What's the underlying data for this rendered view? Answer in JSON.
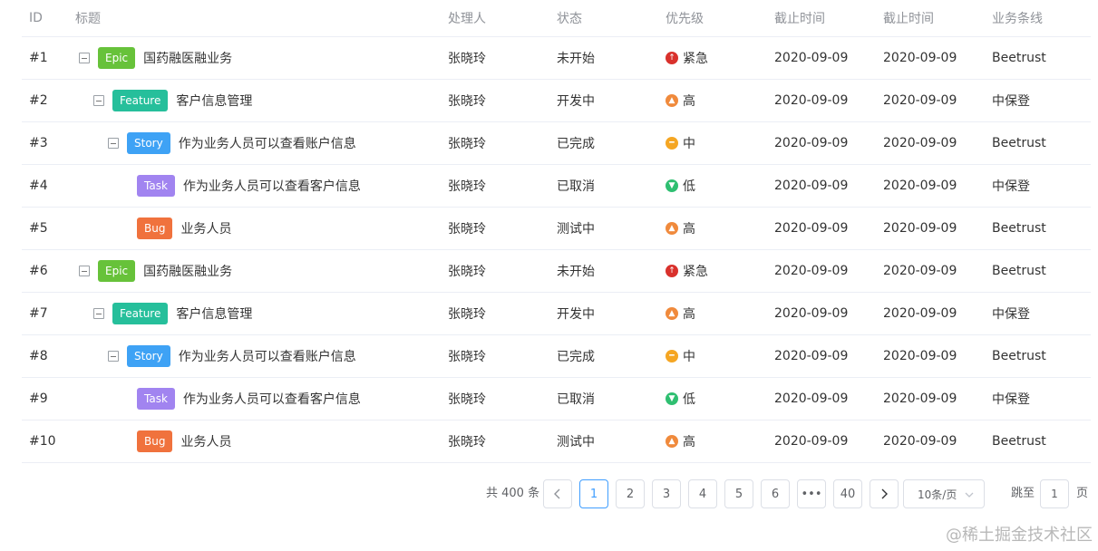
{
  "columns": {
    "id": "ID",
    "title": "标题",
    "owner": "处理人",
    "status": "状态",
    "priority": "优先级",
    "deadline1": "截止时间",
    "deadline2": "截止时间",
    "business_line": "业务条线"
  },
  "rows": [
    {
      "id": "#1",
      "level": 0,
      "collapsible": true,
      "tag": "Epic",
      "title": "国药融医融业务",
      "owner": "张晓玲",
      "status": "未开始",
      "priority": "紧急",
      "deadline1": "2020-09-09",
      "deadline2": "2020-09-09",
      "business_line": "Beetrust"
    },
    {
      "id": "#2",
      "level": 1,
      "collapsible": true,
      "tag": "Feature",
      "title": "客户信息管理",
      "owner": "张晓玲",
      "status": "开发中",
      "priority": "高",
      "deadline1": "2020-09-09",
      "deadline2": "2020-09-09",
      "business_line": "中保登"
    },
    {
      "id": "#3",
      "level": 2,
      "collapsible": true,
      "tag": "Story",
      "title": "作为业务人员可以查看账户信息",
      "owner": "张晓玲",
      "status": "已完成",
      "priority": "中",
      "deadline1": "2020-09-09",
      "deadline2": "2020-09-09",
      "business_line": "Beetrust"
    },
    {
      "id": "#4",
      "level": 3,
      "collapsible": false,
      "tag": "Task",
      "title": "作为业务人员可以查看客户信息",
      "owner": "张晓玲",
      "status": "已取消",
      "priority": "低",
      "deadline1": "2020-09-09",
      "deadline2": "2020-09-09",
      "business_line": "中保登"
    },
    {
      "id": "#5",
      "level": 3,
      "collapsible": false,
      "tag": "Bug",
      "title": "业务人员",
      "owner": "张晓玲",
      "status": "测试中",
      "priority": "高",
      "deadline1": "2020-09-09",
      "deadline2": "2020-09-09",
      "business_line": "Beetrust"
    },
    {
      "id": "#6",
      "level": 0,
      "collapsible": true,
      "tag": "Epic",
      "title": "国药融医融业务",
      "owner": "张晓玲",
      "status": "未开始",
      "priority": "紧急",
      "deadline1": "2020-09-09",
      "deadline2": "2020-09-09",
      "business_line": "Beetrust"
    },
    {
      "id": "#7",
      "level": 1,
      "collapsible": true,
      "tag": "Feature",
      "title": "客户信息管理",
      "owner": "张晓玲",
      "status": "开发中",
      "priority": "高",
      "deadline1": "2020-09-09",
      "deadline2": "2020-09-09",
      "business_line": "中保登"
    },
    {
      "id": "#8",
      "level": 2,
      "collapsible": true,
      "tag": "Story",
      "title": "作为业务人员可以查看账户信息",
      "owner": "张晓玲",
      "status": "已完成",
      "priority": "中",
      "deadline1": "2020-09-09",
      "deadline2": "2020-09-09",
      "business_line": "Beetrust"
    },
    {
      "id": "#9",
      "level": 3,
      "collapsible": false,
      "tag": "Task",
      "title": "作为业务人员可以查看客户信息",
      "owner": "张晓玲",
      "status": "已取消",
      "priority": "低",
      "deadline1": "2020-09-09",
      "deadline2": "2020-09-09",
      "business_line": "中保登"
    },
    {
      "id": "#10",
      "level": 3,
      "collapsible": false,
      "tag": "Bug",
      "title": "业务人员",
      "owner": "张晓玲",
      "status": "测试中",
      "priority": "高",
      "deadline1": "2020-09-09",
      "deadline2": "2020-09-09",
      "business_line": "Beetrust"
    }
  ],
  "tag_colors": {
    "Epic": "#67c23a",
    "Feature": "#26bf9b",
    "Story": "#3ea2f5",
    "Task": "#a184f0",
    "Bug": "#f0723d"
  },
  "priority_styles": {
    "紧急": {
      "color": "#d9312c",
      "icon": "arrow-up-icon"
    },
    "高": {
      "color": "#f08a3c",
      "icon": "chevron-up-icon"
    },
    "中": {
      "color": "#f5a623",
      "icon": "minus-icon"
    },
    "低": {
      "color": "#2fbf71",
      "icon": "chevron-down-icon"
    }
  },
  "pagination": {
    "total_text": "共 400 条",
    "pages": [
      "1",
      "2",
      "3",
      "4",
      "5",
      "6",
      "•••",
      "40"
    ],
    "current": "1",
    "page_size": "10条/页",
    "jump_prefix": "跳至",
    "jump_value": "1",
    "jump_suffix": "页"
  },
  "watermark": "@稀土掘金技术社区"
}
